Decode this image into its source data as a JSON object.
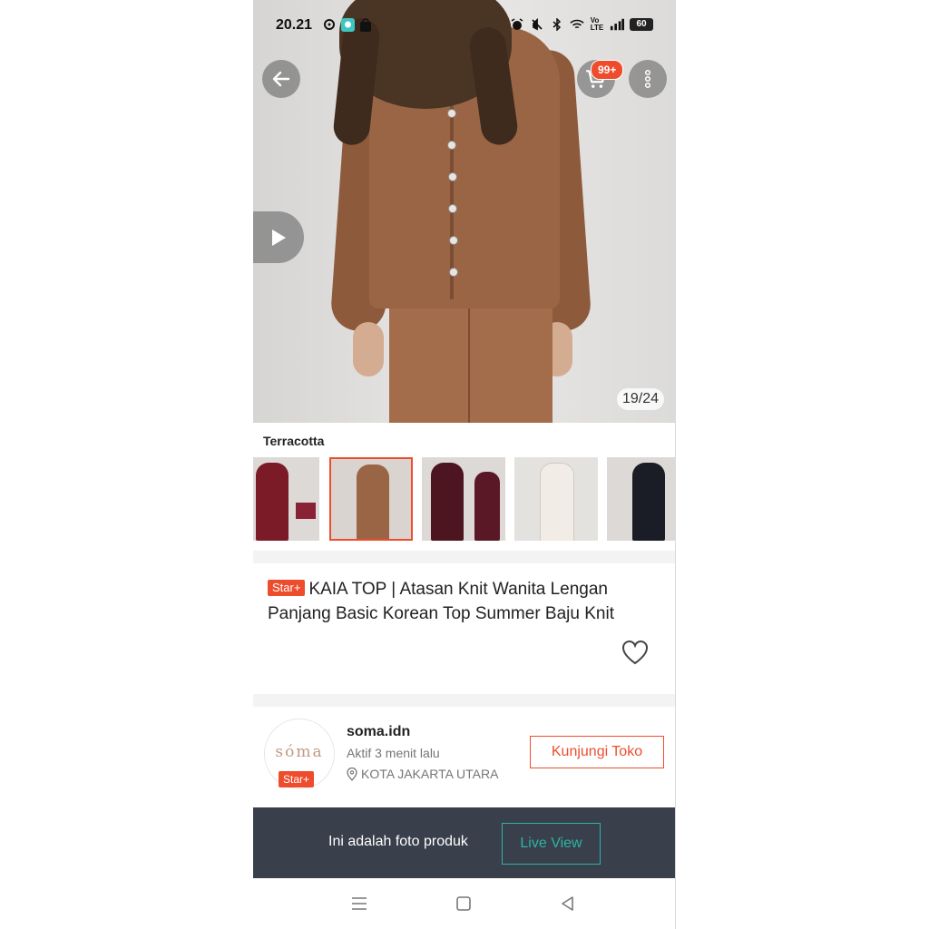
{
  "status_bar": {
    "time": "20.21",
    "battery": "60"
  },
  "product_image": {
    "counter": "19/24",
    "cart_badge": "99+"
  },
  "variant": {
    "selected_name": "Terracotta",
    "thumbnails": [
      {
        "name": "maroon"
      },
      {
        "name": "terracotta",
        "selected": true
      },
      {
        "name": "burgundy"
      },
      {
        "name": "cream"
      },
      {
        "name": "black"
      }
    ]
  },
  "product": {
    "badge": "Star+",
    "title": "KAIA TOP | Atasan Knit Wanita Lengan Panjang Basic Korean Top Summer Baju Knit"
  },
  "shop": {
    "logo_text": "sóma",
    "badge": "Star+",
    "name": "soma.idn",
    "active_status": "Aktif 3 menit lalu",
    "location": "KOTA JAKARTA UTARA",
    "visit_label": "Kunjungi Toko"
  },
  "banner": {
    "text": "Ini adalah foto produk",
    "button_label": "Live View"
  },
  "colors": {
    "accent": "#ee4d2d",
    "banner_bg": "#3a3f4c",
    "live_view": "#2bb5a3"
  },
  "icons": [
    "back-arrow-icon",
    "cart-icon",
    "more-vertical-icon",
    "play-icon",
    "heart-icon",
    "location-pin-icon",
    "menu-icon",
    "home-square-icon",
    "back-triangle-icon"
  ]
}
